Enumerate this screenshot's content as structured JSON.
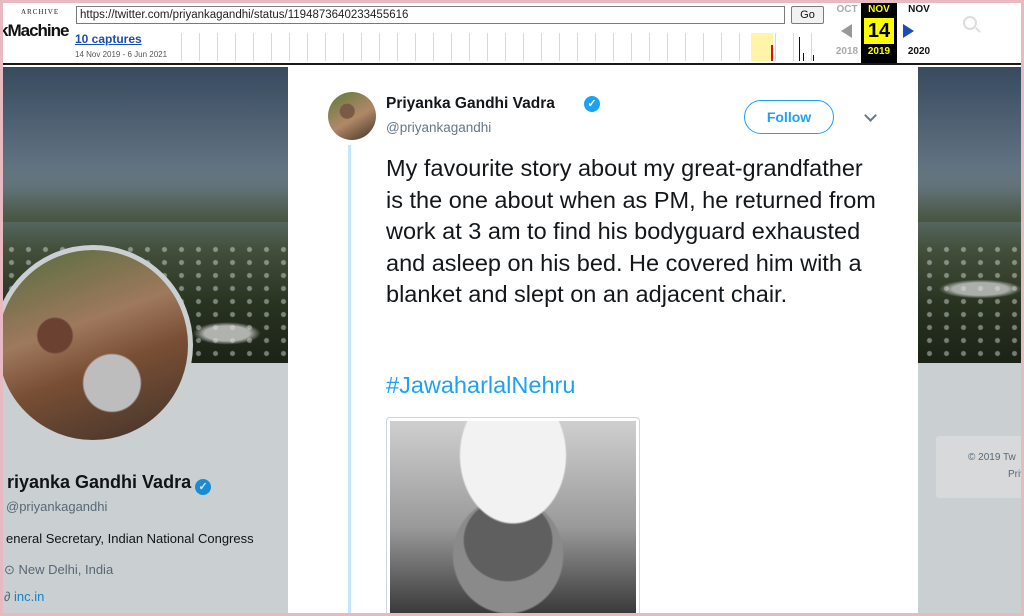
{
  "wayback": {
    "logo_top": "ARCHIVE",
    "logo_bottom": "kMachine",
    "url": "https://twitter.com/priyankagandhi/status/1194873640233455616",
    "go_label": "Go",
    "captures": "10 captures",
    "range": "14 Nov 2019 - 6 Jun 2021",
    "prev": {
      "month": "OCT",
      "year": "2018"
    },
    "current": {
      "month": "NOV",
      "day": "14",
      "year": "2019"
    },
    "next": {
      "month": "NOV",
      "year": "2020"
    }
  },
  "profile": {
    "name": "riyanka Gandhi Vadra",
    "handle": "priyankagandhi",
    "bio": "eneral Secretary, Indian National Congress",
    "location": "New Delhi, India",
    "link": "inc.in",
    "footer_line1": "© 2019 Tw",
    "footer_line2": "Priva"
  },
  "tweet": {
    "author_name": "Priyanka Gandhi Vadra",
    "verified_mark": "✓",
    "author_handle": "@priyankagandhi",
    "follow_label": "Follow",
    "text": "My favourite story about my great-grandfather is the one about when as PM, he returned from work at 3 am to find his bodyguard exhausted and asleep on his bed. He covered him with a blanket and slept on an adjacent chair.",
    "hashtag": "#JawaharlalNehru"
  },
  "colors": {
    "twitter_blue": "#1da1f2",
    "frame_pink": "#e8b9c0",
    "wayback_highlight": "#ffff00"
  }
}
